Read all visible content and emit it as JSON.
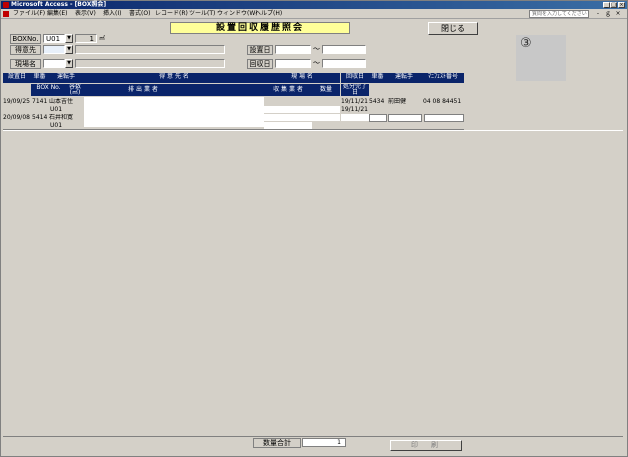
{
  "app": {
    "title": "Microsoft Access - [BOX照会]"
  },
  "titlebar_buttons": [
    "_",
    "□",
    "×"
  ],
  "menu": {
    "items": [
      "ファイル(F)",
      "編集(E)",
      "表示(V)",
      "挿入(I)",
      "書式(O)",
      "レコード(R)",
      "ツール(T)",
      "ウィンドウ(W)",
      "ヘルプ(H)"
    ],
    "help_placeholder": "質問を入力してください",
    "mdi_buttons": [
      "-",
      "ｇ",
      "×"
    ]
  },
  "form": {
    "title": "設置回収履歴照会",
    "close_label": "閉じる",
    "box_no_label": "BOXNo.",
    "box_no_value": "U01",
    "box_size_value": "1",
    "box_unit": "㎥",
    "client_label": "得意先",
    "site_label": "現場名",
    "install_label": "設置日",
    "collect_label": "回収日",
    "range_sep": "～",
    "circle_mark": "③",
    "combo_arrow": "▼"
  },
  "table": {
    "headers_row1": [
      "設置日",
      "車番",
      "運転手",
      "得 意 先 名",
      "現 場 名",
      "回収日",
      "車番",
      "運転手",
      "ﾏﾆﾌｪｽﾄ番号"
    ],
    "headers_row2": [
      "BOX No.",
      "容数(㎥)",
      "排 出 業 者",
      "収 集 業 者",
      "数量",
      "処分完了日"
    ],
    "records": [
      {
        "install_date": "19/09/25",
        "car_no": "7141",
        "driver": "山本吉住",
        "box_no": "U01",
        "collect_date": "19/11/21",
        "qty": "1",
        "dispose_date": "19/11/21",
        "collect_car": "5434",
        "collect_driver": "前田健",
        "manifest": "04 08 84451"
      },
      {
        "install_date": "20/09/08",
        "car_no": "5414",
        "driver": "石井和寛",
        "box_no": "U01"
      }
    ]
  },
  "footer": {
    "total_label": "数量合計",
    "total_value": "1",
    "print_label": "印　刷"
  }
}
